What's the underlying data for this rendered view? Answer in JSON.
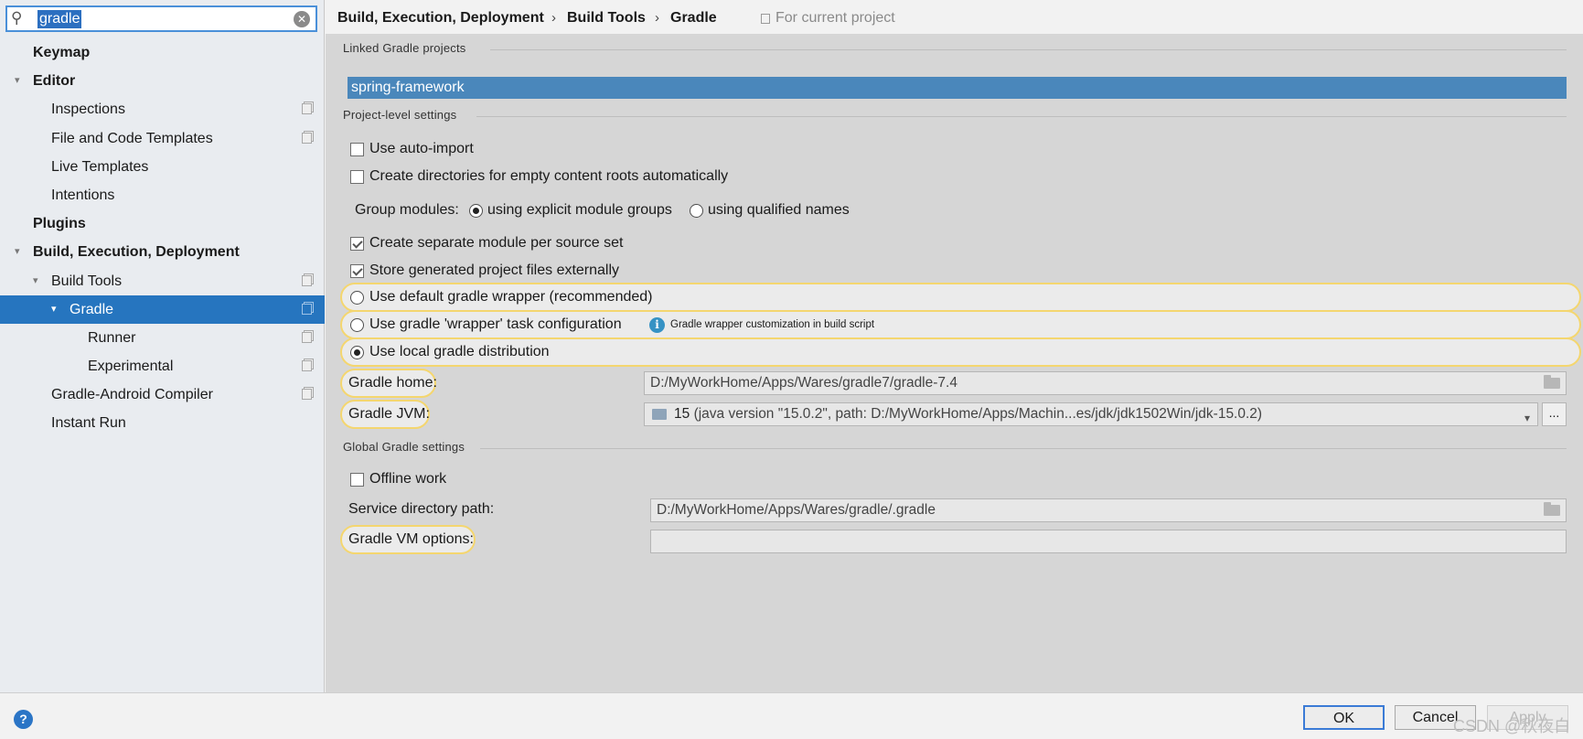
{
  "search": {
    "value": "gradle",
    "icon": "search-icon",
    "clear_icon": "clear-icon"
  },
  "sidebar": {
    "items": [
      {
        "label": "Keymap",
        "bold": true,
        "arrow": ""
      },
      {
        "label": "Editor",
        "bold": true,
        "arrow": "▾"
      },
      {
        "label": "Inspections",
        "copy": true
      },
      {
        "label": "File and Code Templates",
        "copy": true
      },
      {
        "label": "Live Templates"
      },
      {
        "label": "Intentions"
      },
      {
        "label": "Plugins",
        "bold": true
      },
      {
        "label": "Build, Execution, Deployment",
        "bold": true,
        "arrow": "▾"
      },
      {
        "label": "Build Tools",
        "arrow": "▾",
        "copy": true
      },
      {
        "label": "Gradle",
        "arrow": "▾",
        "copy": true,
        "selected": true
      },
      {
        "label": "Runner",
        "copy": true
      },
      {
        "label": "Experimental",
        "copy": true
      },
      {
        "label": "Gradle-Android Compiler",
        "copy": true
      },
      {
        "label": "Instant Run"
      }
    ]
  },
  "header": {
    "crumb1": "Build, Execution, Deployment",
    "crumb2": "Build Tools",
    "crumb3": "Gradle",
    "sep": "›",
    "scope": "For current project"
  },
  "linked": {
    "title": "Linked Gradle projects",
    "project": "spring-framework"
  },
  "project": {
    "title": "Project-level settings",
    "auto_import": "Use auto-import",
    "create_dirs": "Create directories for empty content roots automatically",
    "group_modules": "Group modules:",
    "explicit": "using explicit module groups",
    "qualified": "using qualified names",
    "separate": "Create separate module per source set",
    "store_external": "Store generated project files externally",
    "default_wrapper": "Use default gradle wrapper (recommended)",
    "wrapper_task": "Use gradle 'wrapper' task configuration",
    "wrapper_hint": "Gradle wrapper customization in build script",
    "local_dist": "Use local gradle distribution",
    "gradle_home_label": "Gradle home:",
    "gradle_home": "D:/MyWorkHome/Apps/Wares/gradle7/gradle-7.4",
    "jvm_label": "Gradle JVM:",
    "jvm_version": "15",
    "jvm_detail": "(java version \"15.0.2\", path: D:/MyWorkHome/Apps/Machin...es/jdk/jdk1502Win/jdk-15.0.2)",
    "dots": "..."
  },
  "global": {
    "title": "Global Gradle settings",
    "offline": "Offline work",
    "service_label": "Service directory path:",
    "service_path": "D:/MyWorkHome/Apps/Wares/gradle/.gradle",
    "vm_label": "Gradle VM options:",
    "vm_value": ""
  },
  "footer": {
    "help": "?",
    "ok": "OK",
    "cancel": "Cancel",
    "apply": "Apply",
    "watermark": "CSDN @秋夜白"
  },
  "colors": {
    "selection": "#2675bf",
    "highlight": "#f4d66f",
    "list_selection": "#4a87bb"
  }
}
